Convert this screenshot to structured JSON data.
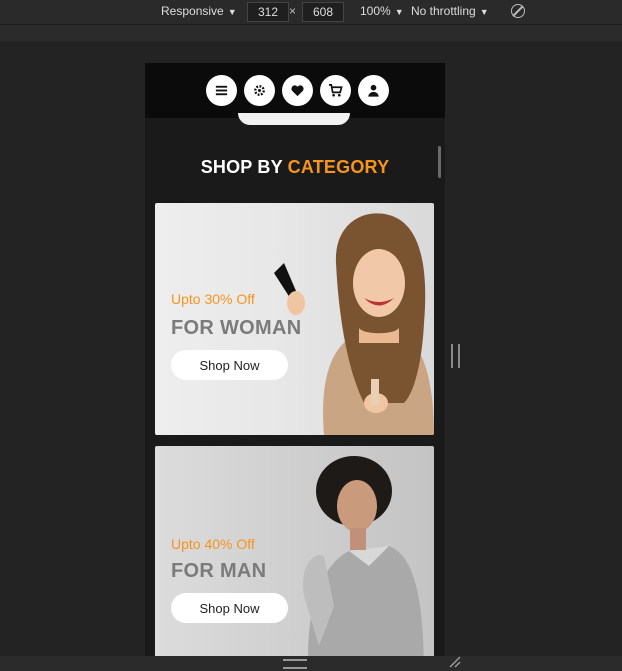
{
  "devtools": {
    "device": "Responsive",
    "width": "312",
    "height": "608",
    "times": "×",
    "zoom": "100%",
    "throttling": "No throttling"
  },
  "navbar": {
    "icons": [
      "menu-icon",
      "gear-icon",
      "heart-icon",
      "cart-icon",
      "user-icon"
    ]
  },
  "section": {
    "title_main": "SHOP BY ",
    "title_accent": "CATEGORY"
  },
  "cards": [
    {
      "offer": "Upto 30% Off",
      "heading": "FOR WOMAN",
      "button": "Shop Now"
    },
    {
      "offer": "Upto 40% Off",
      "heading": "FOR MAN",
      "button": "Shop Now"
    }
  ],
  "colors": {
    "accent": "#f7941d",
    "navbar": "#0b0b0b",
    "page": "#1a1a1a"
  }
}
